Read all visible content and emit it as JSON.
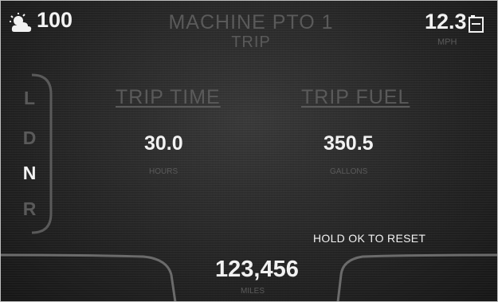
{
  "top_bar": {
    "weather_icon": "partly-sunny-icon",
    "temperature": "100",
    "title": "MACHINE PTO 1",
    "subtitle": "TRIP",
    "fuel_value": "12.3",
    "fuel_icon": "battery-fuel-icon",
    "fuel_unit": "MPH"
  },
  "gear_selector": {
    "gears": [
      "L",
      "D",
      "N",
      "R"
    ],
    "active_gear": "N"
  },
  "stats": [
    {
      "label": "TRIP TIME",
      "value": "30.0",
      "unit": "HOURS"
    },
    {
      "label": "TRIP FUEL",
      "value": "350.5",
      "unit": "GALLONS"
    }
  ],
  "reset_hint": "HOLD OK TO RESET",
  "odometer": {
    "value": "123,456",
    "unit": "MILES"
  },
  "colors": {
    "active": "#f2f2f2",
    "inactive": "#5a5a5a",
    "background": "#262626"
  }
}
